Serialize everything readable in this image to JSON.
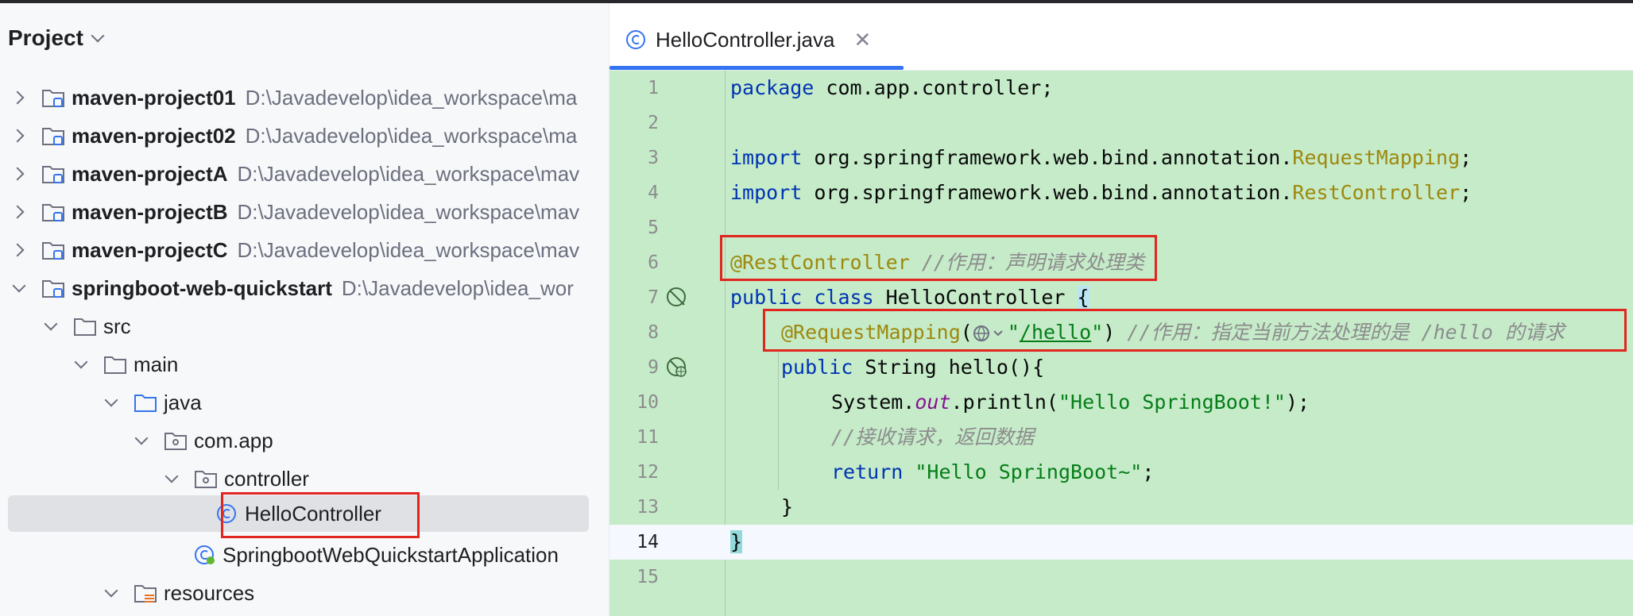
{
  "project_panel": {
    "title": "Project",
    "tree": [
      {
        "name": "maven-project01",
        "path": "D:\\Javadevelop\\idea_workspace\\ma"
      },
      {
        "name": "maven-project02",
        "path": "D:\\Javadevelop\\idea_workspace\\ma"
      },
      {
        "name": "maven-projectA",
        "path": "D:\\Javadevelop\\idea_workspace\\mav"
      },
      {
        "name": "maven-projectB",
        "path": "D:\\Javadevelop\\idea_workspace\\mav"
      },
      {
        "name": "maven-projectC",
        "path": "D:\\Javadevelop\\idea_workspace\\mav"
      },
      {
        "name": "springboot-web-quickstart",
        "path": "D:\\Javadevelop\\idea_wor"
      },
      {
        "name": "src"
      },
      {
        "name": "main"
      },
      {
        "name": "java"
      },
      {
        "name": "com.app"
      },
      {
        "name": "controller"
      },
      {
        "name": "HelloController"
      },
      {
        "name": "SpringbootWebQuickstartApplication"
      },
      {
        "name": "resources"
      }
    ]
  },
  "editor": {
    "tab_label": "HelloController.java",
    "line_numbers": [
      "1",
      "2",
      "3",
      "4",
      "5",
      "6",
      "7",
      "8",
      "9",
      "10",
      "11",
      "12",
      "13",
      "14",
      "15"
    ],
    "code": {
      "l1_kw": "package",
      "l1_rest": " com.app.controller;",
      "l3_kw": "import",
      "l3_pkg": " org.springframework.web.bind.annotation.",
      "l3_cls": "RequestMapping",
      "l3_end": ";",
      "l4_kw": "import",
      "l4_pkg": " org.springframework.web.bind.annotation.",
      "l4_cls": "RestController",
      "l4_end": ";",
      "l6_ann": "@RestController",
      "l6_cmt": " //作用：声明请求处理类",
      "l7_kw": "public class",
      "l7_name": " HelloController ",
      "l7_brace": "{",
      "l8_ann": "@RequestMapping",
      "l8_open": "(",
      "l8_q1": "\"",
      "l8_path": "/hello",
      "l8_q2": "\"",
      "l8_close": ")",
      "l8_cmt": " //作用：指定当前方法处理的是 /hello 的请求",
      "l9_kw": "public",
      "l9_rest": " String hello(){",
      "l10_a": "System.",
      "l10_b": "out",
      "l10_c": ".println(",
      "l10_str": "\"Hello SpringBoot!\"",
      "l10_d": ");",
      "l11_cmt": "//接收请求，返回数据",
      "l12_kw": "return",
      "l12_str": " \"Hello SpringBoot~\"",
      "l12_end": ";",
      "l13": "}",
      "l14": "}"
    }
  },
  "colors": {
    "editor_bg": "#c5ebc9",
    "keyword": "#0033b3",
    "annotation": "#9e880d",
    "string": "#067d17",
    "comment": "#8c8c8c",
    "highlight_box": "#e0261f",
    "tab_underline": "#3574f0"
  }
}
